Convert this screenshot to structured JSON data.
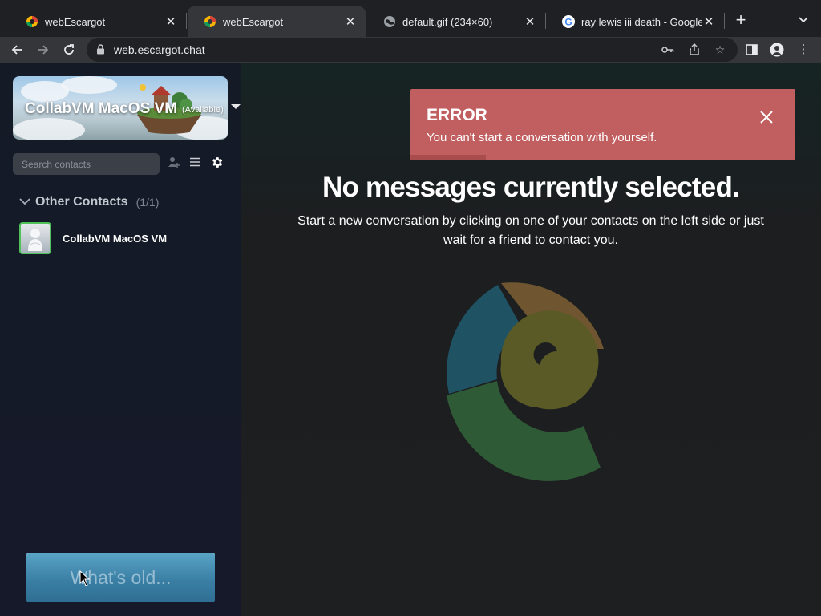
{
  "browser": {
    "tabs": [
      {
        "title": "webEscargot",
        "favicon": "escargot-favicon"
      },
      {
        "title": "webEscargot",
        "favicon": "escargot-favicon"
      },
      {
        "title": "default.gif (234×60)",
        "favicon": "globe-icon"
      },
      {
        "title": "ray lewis iii death - Google S",
        "favicon": "google-icon"
      }
    ],
    "url": "web.escargot.chat"
  },
  "sidebar": {
    "profile": {
      "name": "CollabVM MacOS VM",
      "status": "(Available)"
    },
    "search_placeholder": "Search contacts",
    "group": {
      "name": "Other Contacts",
      "count": "(1/1)"
    },
    "contacts": [
      {
        "name": "CollabVM MacOS VM",
        "status_color": "#51c25a"
      }
    ],
    "whats_old_placeholder": "What's old..."
  },
  "main": {
    "heading": "No messages currently selected.",
    "subtext": "Start a new conversation by clicking on one of your contacts on the left side or just wait for a friend to contact you."
  },
  "toast": {
    "title": "ERROR",
    "message": "You can't start a conversation with yourself.",
    "color": "#c15e5f"
  },
  "colors": {
    "logo_blue": "#1f5363",
    "logo_orange": "#6f5630",
    "logo_olive": "#595a25",
    "logo_green": "#2f5a36"
  }
}
